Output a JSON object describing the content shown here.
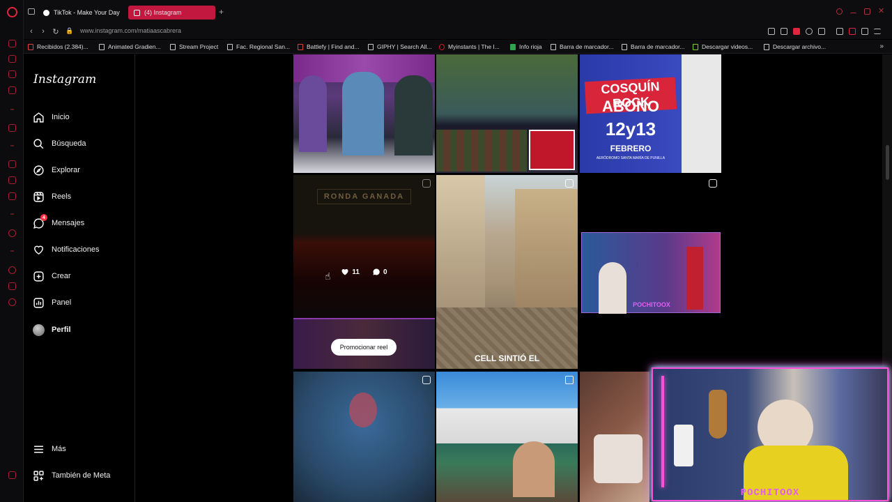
{
  "tabs": [
    {
      "label": "TikTok - Make Your Day",
      "active": false
    },
    {
      "label": "(4) Instagram",
      "active": true
    }
  ],
  "address": {
    "url": "www.instagram.com/matiaascabrera"
  },
  "bookmarks": [
    "Recibidos (2.384)...",
    "Animated Gradien...",
    "Stream Project",
    "Fac. Regional San...",
    "Battlefy | Find and...",
    "GIPHY | Search All...",
    "Myinstants | The I...",
    "Info rioja",
    "Barra de marcador...",
    "Barra de marcador...",
    "Descargar videos...",
    "Descargar archivo..."
  ],
  "sidebar": {
    "logo": "Instagram",
    "items": [
      {
        "label": "Inicio",
        "icon": "home-icon"
      },
      {
        "label": "Búsqueda",
        "icon": "search-icon"
      },
      {
        "label": "Explorar",
        "icon": "compass-icon"
      },
      {
        "label": "Reels",
        "icon": "reels-icon"
      },
      {
        "label": "Mensajes",
        "icon": "messenger-icon",
        "badge": "4"
      },
      {
        "label": "Notificaciones",
        "icon": "heart-icon"
      },
      {
        "label": "Crear",
        "icon": "plus-square-icon"
      },
      {
        "label": "Panel",
        "icon": "chart-icon"
      },
      {
        "label": "Perfil",
        "icon": "avatar"
      }
    ],
    "bottom": [
      {
        "label": "Más",
        "icon": "menu-icon"
      },
      {
        "label": "También de Meta",
        "icon": "meta-grid-icon"
      }
    ]
  },
  "grid": {
    "tile_texts": {
      "cosquin_title": "COSQUÍN ROCK",
      "cosquin_sub": "ABONO",
      "cosquin_date": "12y13",
      "cosquin_month": "FEBRERO",
      "cosquin_place": "AERÓDROMO SANTA MARÍA DE PUNILLA",
      "ronda": "RONDA GANADA",
      "cell": "CELL SINTIÓ EL",
      "pochito": "POCHITOOX"
    },
    "hovered_post": {
      "likes": "11",
      "comments": "0"
    },
    "promo_button": "Promocionar reel"
  },
  "webcam": {
    "label": "POCHITOOX"
  },
  "colors": {
    "accent": "#c2183f",
    "badge": "#ff3040",
    "neon_pink": "#ff4fd8",
    "neon_cyan": "#6ef2ff"
  }
}
